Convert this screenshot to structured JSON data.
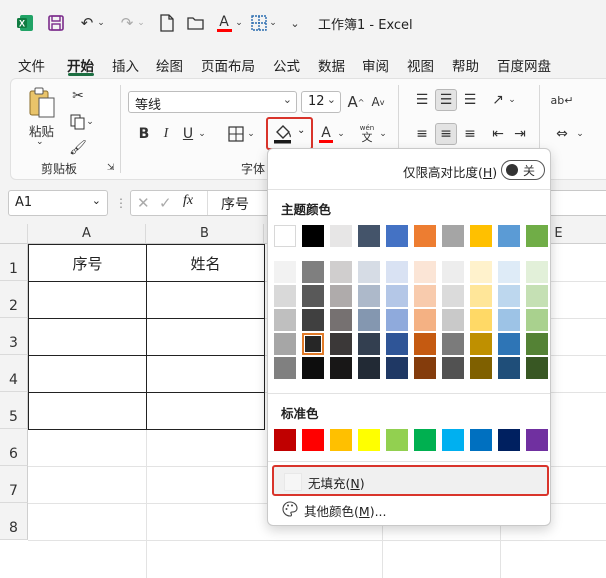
{
  "window": {
    "title": "工作簿1  -  Excel"
  },
  "menu": [
    "文件",
    "开始",
    "插入",
    "绘图",
    "页面布局",
    "公式",
    "数据",
    "审阅",
    "视图",
    "帮助",
    "百度网盘"
  ],
  "ribbon": {
    "paste_label": "粘贴",
    "clipboard_group": "剪贴板",
    "font_group": "字体",
    "font_name": "等线",
    "font_size": "12",
    "bold": "B",
    "italic": "I",
    "underline": "U",
    "grow_font": "A",
    "shrink_font": "A",
    "wen_label": "wén",
    "wen_char": "文",
    "font_color_letter": "A"
  },
  "formula": {
    "cell_ref": "A1",
    "fx": "fx",
    "value": "序号"
  },
  "grid": {
    "columns": [
      "A",
      "B",
      "",
      "",
      "E"
    ],
    "rows": [
      "1",
      "2",
      "3",
      "4",
      "5",
      "6",
      "7",
      "8"
    ],
    "a1": "序号",
    "b1": "姓名"
  },
  "fill_menu": {
    "high_contrast_label": "仅限高对比度(",
    "high_contrast_key": "H",
    "toggle_state": "关",
    "theme_colors_title": "主题颜色",
    "standard_colors_title": "标准色",
    "no_fill_label": "无填充(",
    "no_fill_key": "N",
    "more_colors_label": "其他颜色(",
    "more_colors_key": "M",
    "more_colors_suffix": ")...",
    "paren_close": ")",
    "theme_top": [
      "#FFFFFF",
      "#000000",
      "#E7E6E6",
      "#44546A",
      "#4472C4",
      "#ED7D31",
      "#A5A5A5",
      "#FFC000",
      "#5B9BD5",
      "#70AD47"
    ],
    "theme_shades": [
      [
        "#F2F2F2",
        "#7F7F7F",
        "#D0CECE",
        "#D6DCE5",
        "#D9E2F3",
        "#FBE5D6",
        "#EDEDED",
        "#FFF2CC",
        "#DEEBF7",
        "#E2F0D9"
      ],
      [
        "#D9D9D9",
        "#595959",
        "#AFABAB",
        "#ADB9CA",
        "#B4C7E7",
        "#F8CBAD",
        "#DBDBDB",
        "#FFE699",
        "#BDD7EE",
        "#C5E0B4"
      ],
      [
        "#BFBFBF",
        "#404040",
        "#767171",
        "#8497B0",
        "#8FAADC",
        "#F4B183",
        "#C9C9C9",
        "#FFD966",
        "#9DC3E6",
        "#A9D18E"
      ],
      [
        "#A6A6A6",
        "#262626",
        "#3B3838",
        "#333F50",
        "#2F5597",
        "#C55A11",
        "#7B7B7B",
        "#BF9000",
        "#2E75B6",
        "#548235"
      ],
      [
        "#808080",
        "#0D0D0D",
        "#181717",
        "#222A35",
        "#1F3864",
        "#843C0C",
        "#525252",
        "#7F6000",
        "#1F4E79",
        "#385723"
      ]
    ],
    "standard": [
      "#C00000",
      "#FF0000",
      "#FFC000",
      "#FFFF00",
      "#92D050",
      "#00B050",
      "#00B0F0",
      "#0070C0",
      "#002060",
      "#7030A0"
    ]
  },
  "colors": {
    "excel_green": "#1D6F42",
    "highlight_red": "#D9342B",
    "font_color_bar": "#FF0000"
  }
}
